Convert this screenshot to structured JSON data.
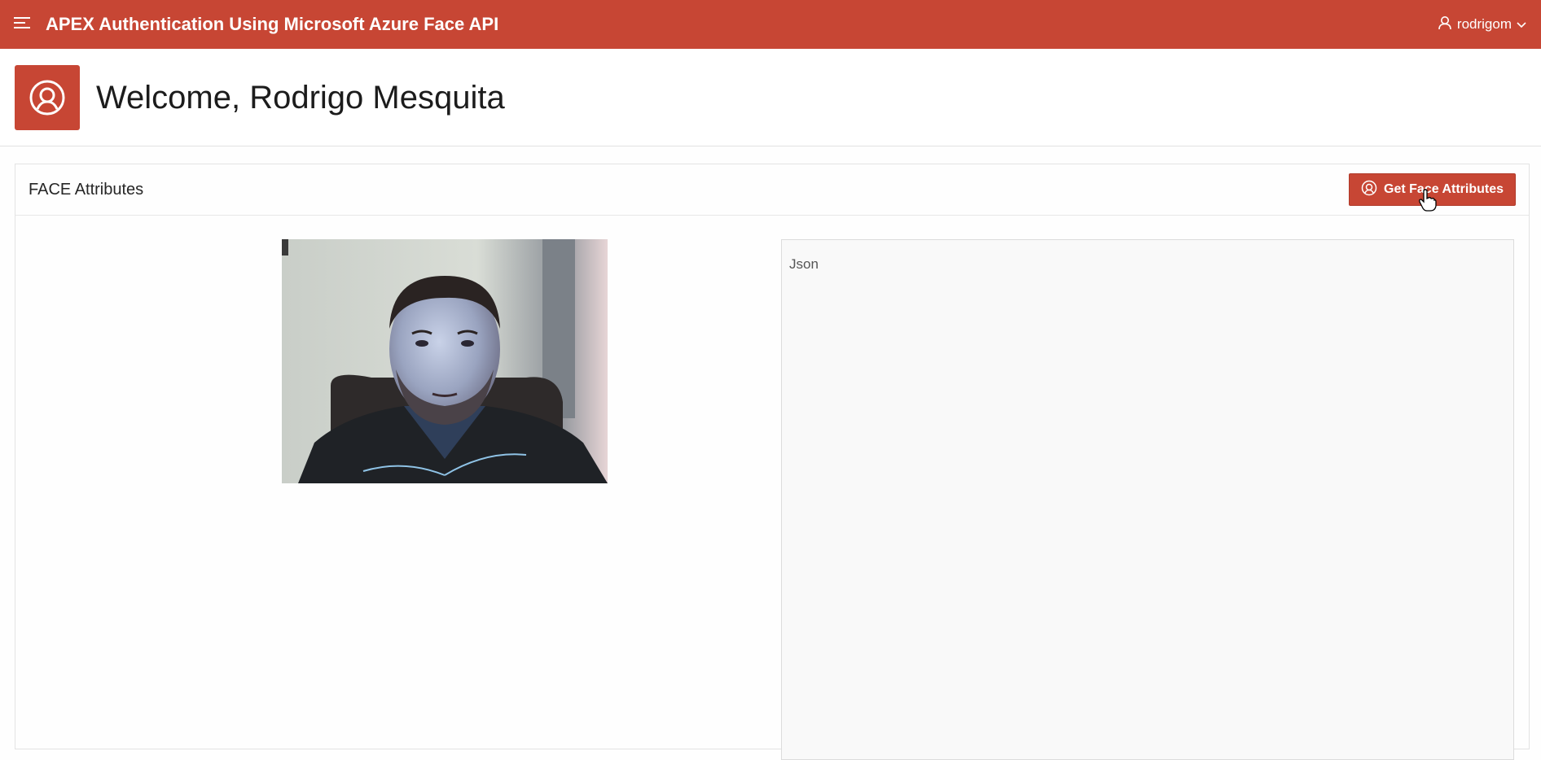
{
  "header": {
    "app_title": "APEX Authentication Using Microsoft Azure Face API",
    "menu_icon": "hamburger-icon",
    "user": {
      "name": "rodrigom",
      "icon": "user-icon",
      "chevron": "chevron-down-icon"
    }
  },
  "hero": {
    "icon": "face-id-icon",
    "title": "Welcome, Rodrigo Mesquita"
  },
  "region": {
    "title": "FACE Attributes",
    "button": {
      "label": "Get Face Attributes",
      "icon": "face-id-icon"
    },
    "photo": {
      "alt": "webcam-photo"
    },
    "json_placeholder": "Json"
  },
  "colors": {
    "brand": "#c74634",
    "panel_bg": "#f9f9f9"
  }
}
